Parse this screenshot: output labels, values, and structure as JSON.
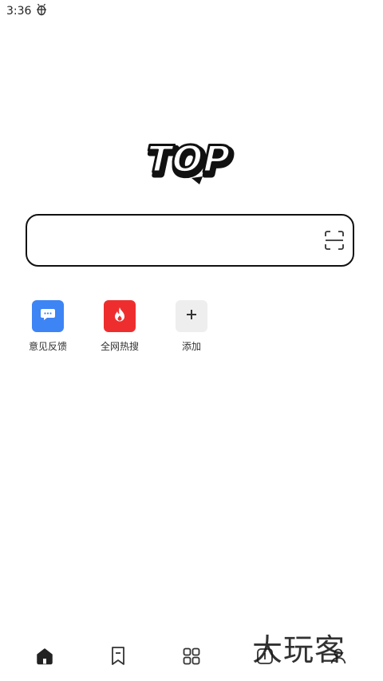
{
  "status_bar": {
    "time": "3:36",
    "notification_icon": "bug-icon"
  },
  "logo": {
    "text": "TOP"
  },
  "search": {
    "value": "",
    "scan_icon": "scan-icon"
  },
  "shortcuts": [
    {
      "label": "意见反馈",
      "icon": "chat-bubble-icon",
      "color": "#3d84f5"
    },
    {
      "label": "全网热搜",
      "icon": "flame-icon",
      "color": "#ee2e2e"
    },
    {
      "label": "添加",
      "icon": "plus-icon",
      "color": "#eeeeee"
    }
  ],
  "bottom_nav": [
    {
      "icon": "home-icon",
      "active": true
    },
    {
      "icon": "bookmark-icon",
      "active": false
    },
    {
      "icon": "grid-icon",
      "active": false
    },
    {
      "icon": "tabs-icon",
      "active": false
    },
    {
      "icon": "profile-icon",
      "active": false
    }
  ],
  "watermark": {
    "text": "大玩客"
  }
}
